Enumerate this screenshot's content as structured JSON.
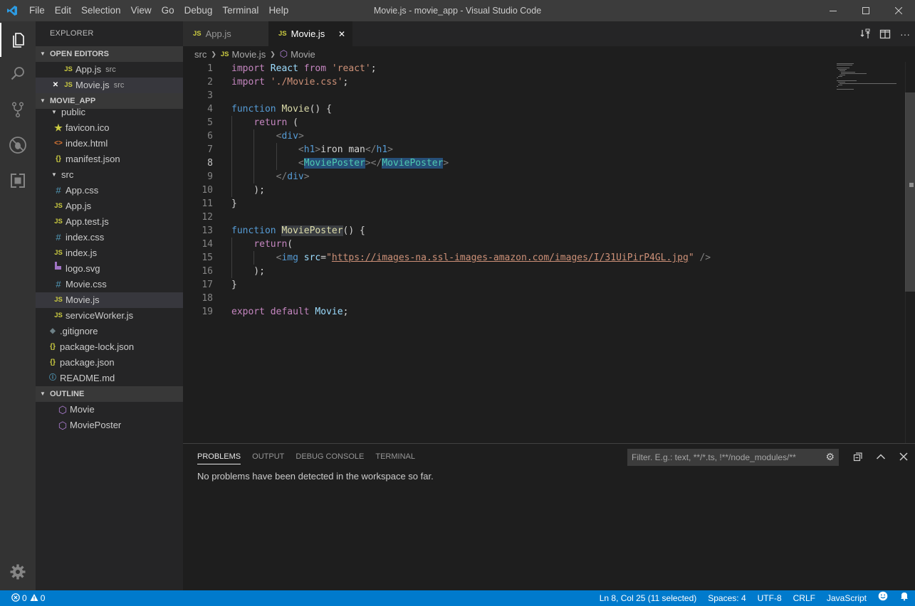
{
  "window": {
    "title": "Movie.js - movie_app - Visual Studio Code",
    "menu": [
      "File",
      "Edit",
      "Selection",
      "View",
      "Go",
      "Debug",
      "Terminal",
      "Help"
    ]
  },
  "sidebar": {
    "title": "EXPLORER",
    "open_editors": {
      "header": "OPEN EDITORS",
      "items": [
        {
          "label": "App.js",
          "desc": "src",
          "icon": "JS"
        },
        {
          "label": "Movie.js",
          "desc": "src",
          "icon": "JS"
        }
      ]
    },
    "project": {
      "header": "MOVIE_APP",
      "items": [
        {
          "label": "public",
          "icon": "chevron-down"
        },
        {
          "label": "favicon.ico",
          "icon": "star"
        },
        {
          "label": "index.html",
          "icon": "<>"
        },
        {
          "label": "manifest.json",
          "icon": "{}"
        },
        {
          "label": "src",
          "icon": "chevron-down"
        },
        {
          "label": "App.css",
          "icon": "#"
        },
        {
          "label": "App.js",
          "icon": "JS"
        },
        {
          "label": "App.test.js",
          "icon": "JS"
        },
        {
          "label": "index.css",
          "icon": "#"
        },
        {
          "label": "index.js",
          "icon": "JS"
        },
        {
          "label": "logo.svg",
          "icon": "svg"
        },
        {
          "label": "Movie.css",
          "icon": "#"
        },
        {
          "label": "Movie.js",
          "icon": "JS"
        },
        {
          "label": "serviceWorker.js",
          "icon": "JS"
        },
        {
          "label": ".gitignore",
          "icon": "git"
        },
        {
          "label": "package-lock.json",
          "icon": "{}"
        },
        {
          "label": "package.json",
          "icon": "{}"
        },
        {
          "label": "README.md",
          "icon": "info"
        }
      ]
    },
    "outline": {
      "header": "OUTLINE",
      "items": [
        "Movie",
        "MoviePoster"
      ]
    }
  },
  "editor": {
    "tabs": [
      {
        "label": "App.js",
        "icon": "JS"
      },
      {
        "label": "Movie.js",
        "icon": "JS"
      }
    ],
    "breadcrumbs": [
      "src",
      "Movie.js",
      "Movie"
    ],
    "current_line": 8,
    "code": {
      "lines": [
        [
          [
            "t-kw",
            "import"
          ],
          [
            "t-plain",
            " "
          ],
          [
            "t-var",
            "React"
          ],
          [
            "t-plain",
            " "
          ],
          [
            "t-kw",
            "from"
          ],
          [
            "t-plain",
            " "
          ],
          [
            "t-str",
            "'react'"
          ],
          [
            "t-plain",
            ";"
          ]
        ],
        [
          [
            "t-kw",
            "import"
          ],
          [
            "t-plain",
            " "
          ],
          [
            "t-str",
            "'./Movie.css'"
          ],
          [
            "t-plain",
            ";"
          ]
        ],
        [],
        [
          [
            "t-tag",
            "function"
          ],
          [
            "t-plain",
            " "
          ],
          [
            "t-fn",
            "Movie"
          ],
          [
            "t-plain",
            "() {"
          ]
        ],
        [
          [
            "t-plain",
            "    "
          ],
          [
            "t-ctl",
            "return"
          ],
          [
            "t-plain",
            " ("
          ]
        ],
        [
          [
            "t-plain",
            "        "
          ],
          [
            "t-tagp",
            "<"
          ],
          [
            "t-tag",
            "div"
          ],
          [
            "t-tagp",
            ">"
          ]
        ],
        [
          [
            "t-plain",
            "            "
          ],
          [
            "t-tagp",
            "<"
          ],
          [
            "t-tag",
            "h1"
          ],
          [
            "t-tagp",
            ">"
          ],
          [
            "t-text",
            "iron man"
          ],
          [
            "t-tagp",
            "</"
          ],
          [
            "t-tag",
            "h1"
          ],
          [
            "t-tagp",
            ">"
          ]
        ],
        [
          [
            "t-plain",
            "            "
          ],
          [
            "t-tagp",
            "<"
          ],
          [
            "t-compsel",
            "MoviePoster"
          ],
          [
            "t-tagp",
            "></"
          ],
          [
            "t-compsel",
            "MoviePoster"
          ],
          [
            "t-tagp",
            ">"
          ]
        ],
        [
          [
            "t-plain",
            "        "
          ],
          [
            "t-tagp",
            "</"
          ],
          [
            "t-tag",
            "div"
          ],
          [
            "t-tagp",
            ">"
          ]
        ],
        [
          [
            "t-plain",
            "    );"
          ]
        ],
        [
          [
            "t-plain",
            "}"
          ]
        ],
        [],
        [
          [
            "t-tag",
            "function"
          ],
          [
            "t-plain",
            " "
          ],
          [
            "t-fnhl",
            "MoviePoster"
          ],
          [
            "t-plain",
            "() {"
          ]
        ],
        [
          [
            "t-plain",
            "    "
          ],
          [
            "t-ctl",
            "return"
          ],
          [
            "t-plain",
            "("
          ]
        ],
        [
          [
            "t-plain",
            "        "
          ],
          [
            "t-tagp",
            "<"
          ],
          [
            "t-tag",
            "img"
          ],
          [
            "t-plain",
            " "
          ],
          [
            "t-attr",
            "src"
          ],
          [
            "t-plain",
            "="
          ],
          [
            "t-str",
            "\""
          ],
          [
            "t-strurl",
            "https://images-na.ssl-images-amazon.com/images/I/31UiPirP4GL.jpg"
          ],
          [
            "t-str",
            "\""
          ],
          [
            "t-plain",
            " "
          ],
          [
            "t-tagp",
            "/>"
          ]
        ],
        [
          [
            "t-plain",
            "    );"
          ]
        ],
        [
          [
            "t-plain",
            "}"
          ]
        ],
        [],
        [
          [
            "t-kw",
            "export"
          ],
          [
            "t-plain",
            " "
          ],
          [
            "t-kw",
            "default"
          ],
          [
            "t-plain",
            " "
          ],
          [
            "t-var",
            "Movie"
          ],
          [
            "t-plain",
            ";"
          ]
        ]
      ]
    }
  },
  "panel": {
    "tabs": [
      "PROBLEMS",
      "OUTPUT",
      "DEBUG CONSOLE",
      "TERMINAL"
    ],
    "filter_placeholder": "Filter. E.g.: text, **/*.ts, !**/node_modules/**",
    "message": "No problems have been detected in the workspace so far."
  },
  "status": {
    "errors": "0",
    "warnings": "0",
    "position": "Ln 8, Col 25 (11 selected)",
    "spaces": "Spaces: 4",
    "encoding": "UTF-8",
    "eol": "CRLF",
    "language": "JavaScript"
  },
  "colors": {
    "accent": "#007acc",
    "titlebar": "#3c3c3c",
    "sidebar": "#252526",
    "editor": "#1e1e1e"
  }
}
